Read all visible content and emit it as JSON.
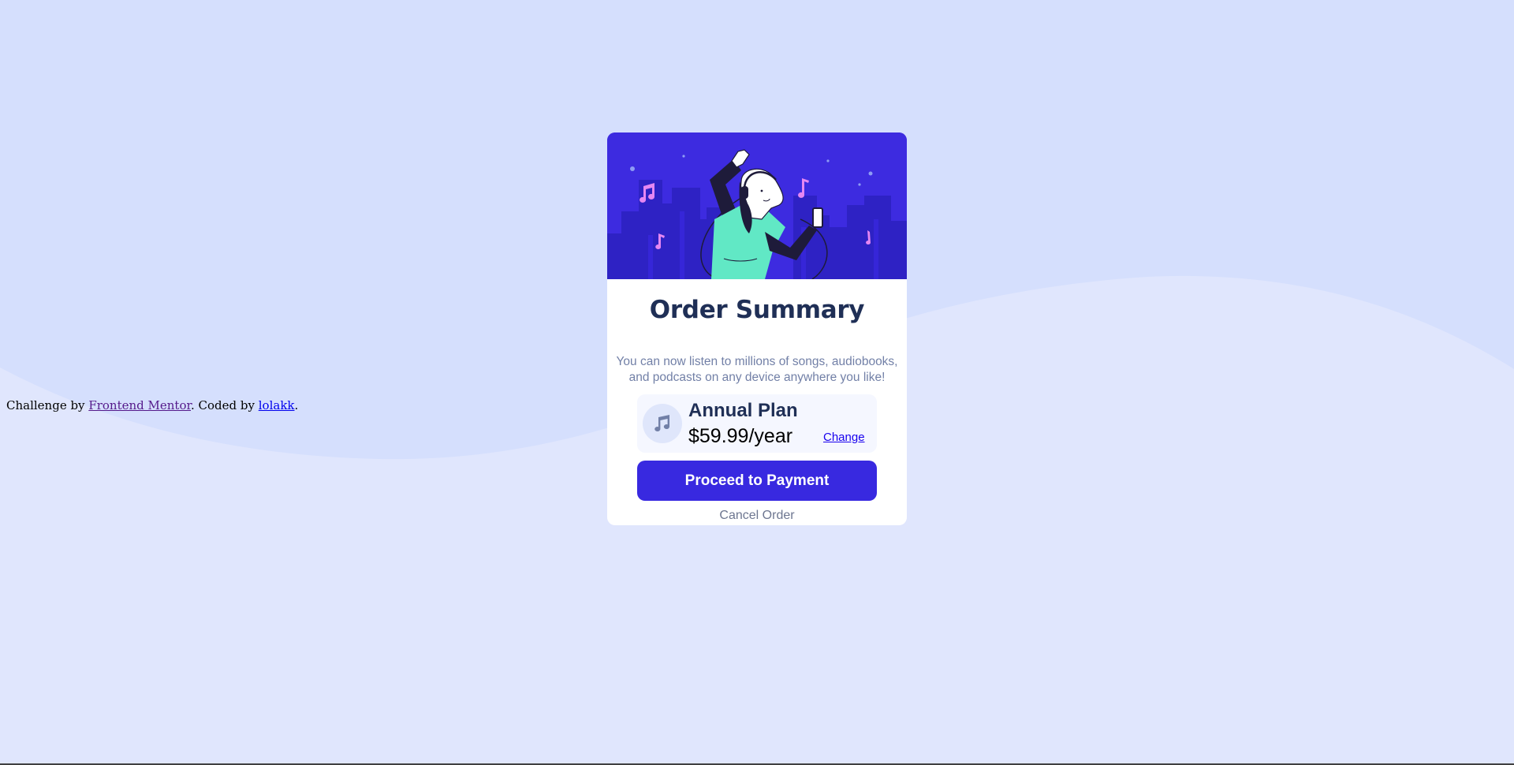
{
  "colors": {
    "background": "#e0e6fd",
    "wave": "#d5dffd",
    "hero_background": "#3d2be0",
    "title": "#1f2f56",
    "description": "#7280a7",
    "primary_button": "#3829e0",
    "plan_panel": "#f5f7ff",
    "link": "#1800ee",
    "cancel": "#6d7690"
  },
  "attribution": {
    "prefix": "Challenge by ",
    "link1": "Frontend Mentor",
    "middle": ". Coded by ",
    "link2": "lolakk",
    "suffix": "."
  },
  "card": {
    "hero_icon": "person-dancing-with-headphones-illustration",
    "title": "Order Summary",
    "description_line1": "You can now listen to millions of songs, audiobooks,",
    "description_line2": "and podcasts on any device anywhere you like!",
    "plan": {
      "icon": "music-note-icon",
      "name": "Annual Plan",
      "price": "$59.99/year",
      "change_label": "Change"
    },
    "proceed_label": "Proceed to Payment",
    "cancel_label": "Cancel Order"
  }
}
